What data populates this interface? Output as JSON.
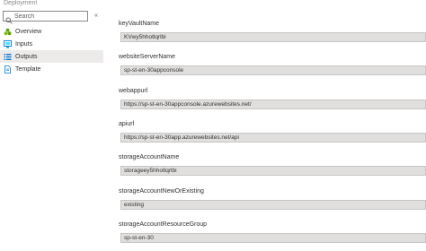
{
  "header": {
    "title": "Deployment"
  },
  "search": {
    "placeholder": "Search"
  },
  "sidebar": {
    "collapse_glyph": "«",
    "items": [
      {
        "label": "Overview",
        "icon": "overview-icon"
      },
      {
        "label": "Inputs",
        "icon": "inputs-icon"
      },
      {
        "label": "Outputs",
        "icon": "outputs-icon",
        "selected": true
      },
      {
        "label": "Template",
        "icon": "template-icon"
      }
    ]
  },
  "outputs": [
    {
      "name": "keyVaultName",
      "value": "KVwy5hhotlqrlbi"
    },
    {
      "name": "websiteServerName",
      "value": "sp-st-en-30appconsole"
    },
    {
      "name": "webappurl",
      "value": "https://sp-st-en-30appconsole.azurewebsites.net/"
    },
    {
      "name": "apiurl",
      "value": "https://sp-st-en-30app.azurewebsites.net/api"
    },
    {
      "name": "storageAccountName",
      "value": "storageey5hhotlqrlbi"
    },
    {
      "name": "storageAccountNewOrExisting",
      "value": "existing"
    },
    {
      "name": "storageAccountResourceGroup",
      "value": "sp-st-en-30"
    }
  ],
  "colors": {
    "selected_bg": "#edebe9",
    "readonly_bg": "#e1dfdd",
    "azure_blue": "#0078d4",
    "overview_green": "#57a300"
  }
}
